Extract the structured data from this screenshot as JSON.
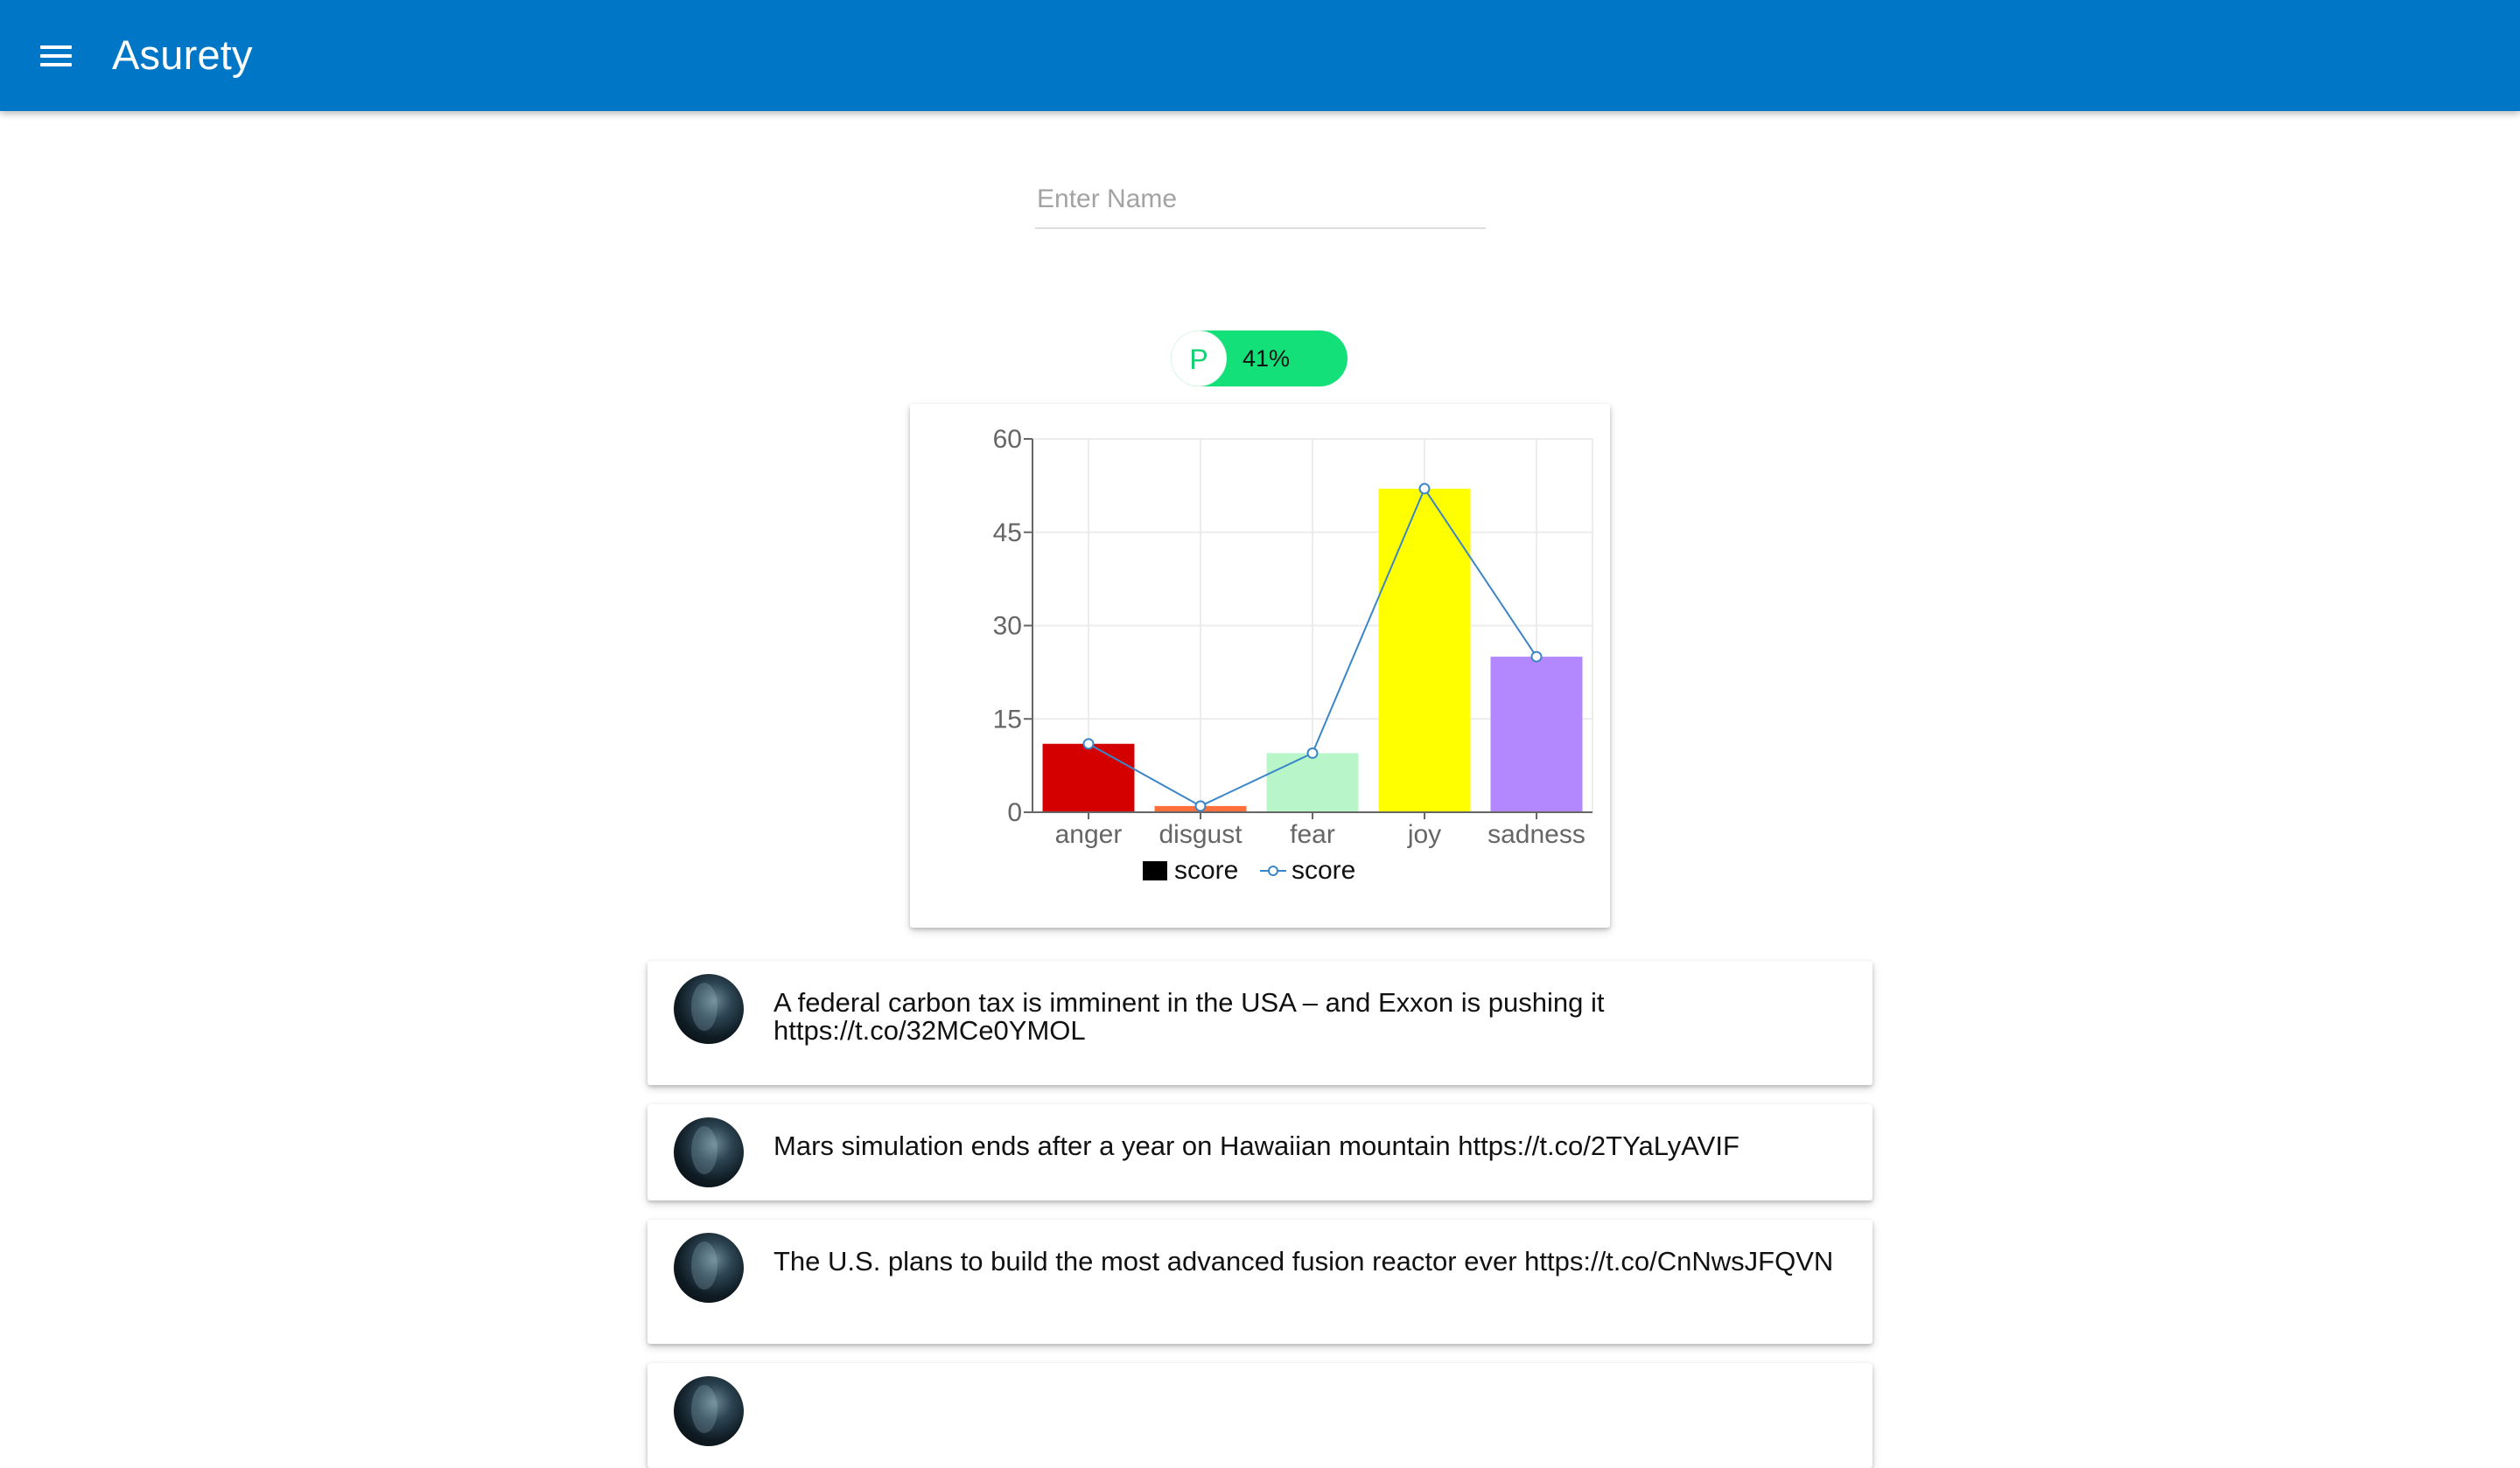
{
  "app_bar": {
    "title": "Asurety",
    "menu_icon": "hamburger-menu-icon"
  },
  "search": {
    "placeholder": "Enter Name",
    "value": ""
  },
  "personality_chip": {
    "avatar_letter": "P",
    "label": "41%",
    "value_percent": 41,
    "color": "#14e07a"
  },
  "chart_data": {
    "type": "bar",
    "categories": [
      "anger",
      "disgust",
      "fear",
      "joy",
      "sadness"
    ],
    "series": [
      {
        "name": "score",
        "type": "bar",
        "values": [
          11,
          1,
          9.5,
          52,
          25
        ]
      },
      {
        "name": "score",
        "type": "line",
        "values": [
          11,
          1,
          9.5,
          52,
          25
        ]
      }
    ],
    "bar_colors": [
      "#d40000",
      "#ff6f3c",
      "#b8f5c8",
      "#ffff00",
      "#b388ff"
    ],
    "line_color": "#3a86c8",
    "ylim": [
      0,
      60
    ],
    "yticks": [
      0,
      15,
      30,
      45,
      60
    ],
    "grid": true,
    "legend_position": "bottom",
    "legend": [
      "score",
      "score"
    ]
  },
  "tweets": [
    {
      "text": "A federal carbon tax is imminent in the USA – and Exxon is pushing it https://t.co/32MCe0YMOL"
    },
    {
      "text": "Mars simulation ends after a year on Hawaiian mountain https://t.co/2TYaLyAVIF"
    },
    {
      "text": "The U.S. plans to build the most advanced fusion reactor ever https://t.co/CnNwsJFQVN"
    },
    {
      "text": ""
    }
  ]
}
